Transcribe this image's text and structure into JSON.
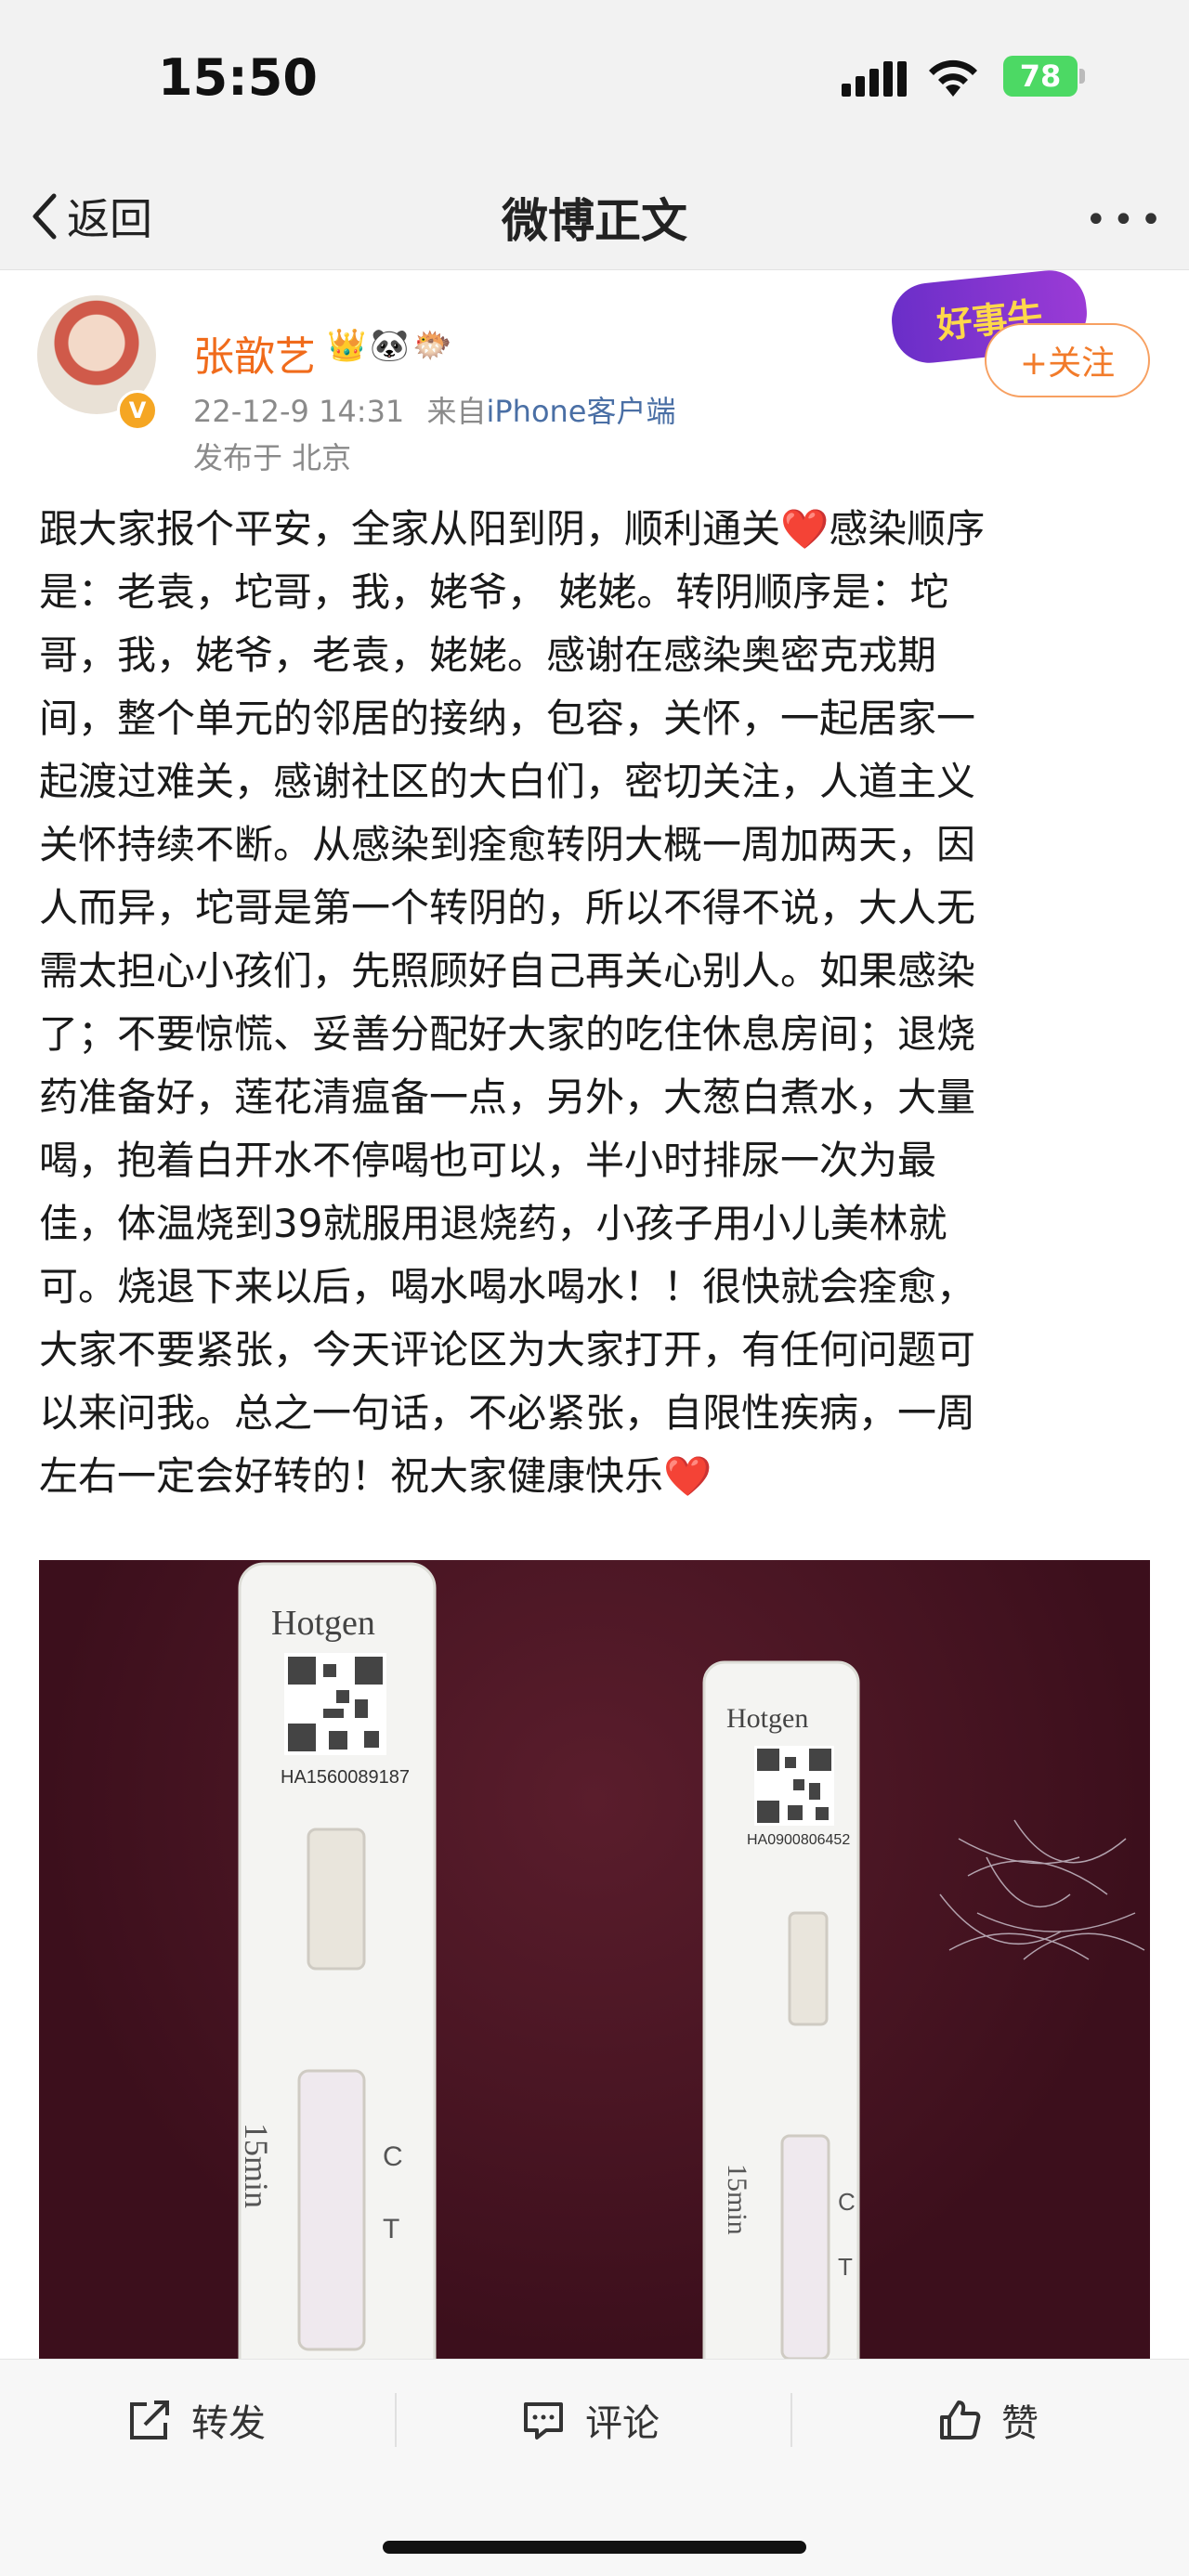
{
  "status_bar": {
    "time": "15:50",
    "battery": "78"
  },
  "nav": {
    "back_label": "返回",
    "title": "微博正文"
  },
  "post": {
    "author": "张歆艺",
    "timestamp": "22-12-9 14:31",
    "source_prefix": "来自",
    "source_client": "iPhone客户端",
    "location": "发布于 北京",
    "brand_badge": "好事牛",
    "follow_label": "+关注",
    "lines": [
      "跟大家报个平安，全家从阳到阴，顺利通关❤️感染顺序",
      "是：老袁，坨哥，我，姥爷， 姥姥。转阴顺序是：坨",
      "哥，我，姥爷，老袁，姥姥。感谢在感染奥密克戎期",
      "间，整个单元的邻居的接纳，包容，关怀，一起居家一",
      "起渡过难关，感谢社区的大白们，密切关注，人道主义",
      "关怀持续不断。从感染到痊愈转阴大概一周加两天，因",
      "人而异，坨哥是第一个转阴的，所以不得不说，大人无",
      "需太担心小孩们，先照顾好自己再关心别人。如果感染",
      "了；不要惊慌、妥善分配好大家的吃住休息房间；退烧",
      "药准备好，莲花清瘟备一点，另外，大葱白煮水，大量",
      "喝，抱着白开水不停喝也可以，半小时排尿一次为最",
      "佳，体温烧到39就服用退烧药，小孩子用小儿美林就",
      "可。烧退下来以后，喝水喝水喝水！！很快就会痊愈，",
      "大家不要紧张，今天评论区为大家打开，有任何问题可",
      "以来问我。总之一句话，不必紧张，自限性疾病，一周",
      "左右一定会好转的！祝大家健康快乐❤️"
    ]
  },
  "photo": {
    "test1": {
      "brand": "Hotgen",
      "serial": "HA1560089187",
      "time_label": "15min",
      "c": "C",
      "t": "T"
    },
    "test2": {
      "brand": "Hotgen",
      "serial": "HA0900806452",
      "time_label": "15min",
      "c": "C",
      "t": "T"
    }
  },
  "toolbar": {
    "repost": "转发",
    "comment": "评论",
    "like": "赞"
  },
  "colors": {
    "username": "#f06b1b",
    "link": "#4a6fa5",
    "follow": "#f27b2a",
    "heart": "#e02020"
  }
}
